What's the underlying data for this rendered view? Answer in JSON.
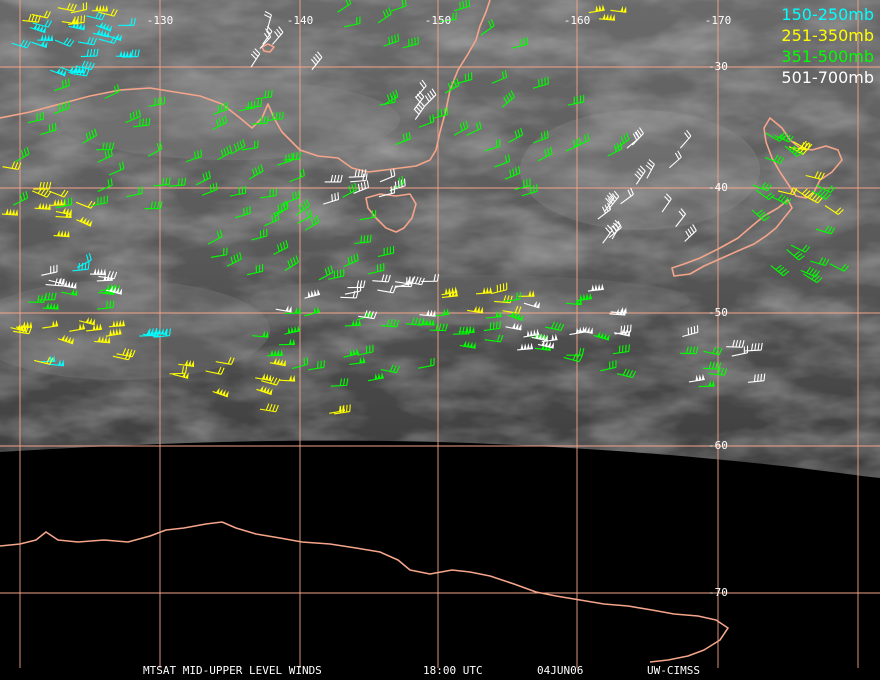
{
  "legend": [
    {
      "label": "150-250mb",
      "color": "#00ffff"
    },
    {
      "label": "251-350mb",
      "color": "#ffff00"
    },
    {
      "label": "351-500mb",
      "color": "#00ff00"
    },
    {
      "label": "501-700mb",
      "color": "#ffffff"
    }
  ],
  "longitudes": [
    "-130",
    "-140",
    "-150",
    "-160",
    "-170"
  ],
  "latitudes": [
    "-30",
    "-40",
    "-50",
    "-60",
    "-70"
  ],
  "footer": {
    "product": "MTSAT MID-UPPER LEVEL WINDS",
    "time": "18:00 UTC",
    "date": "04JUN06",
    "source": "UW-CIMSS"
  },
  "colors": {
    "coastline": "#f4a58a",
    "gridline": "#f4a58a",
    "space": "#000000"
  }
}
